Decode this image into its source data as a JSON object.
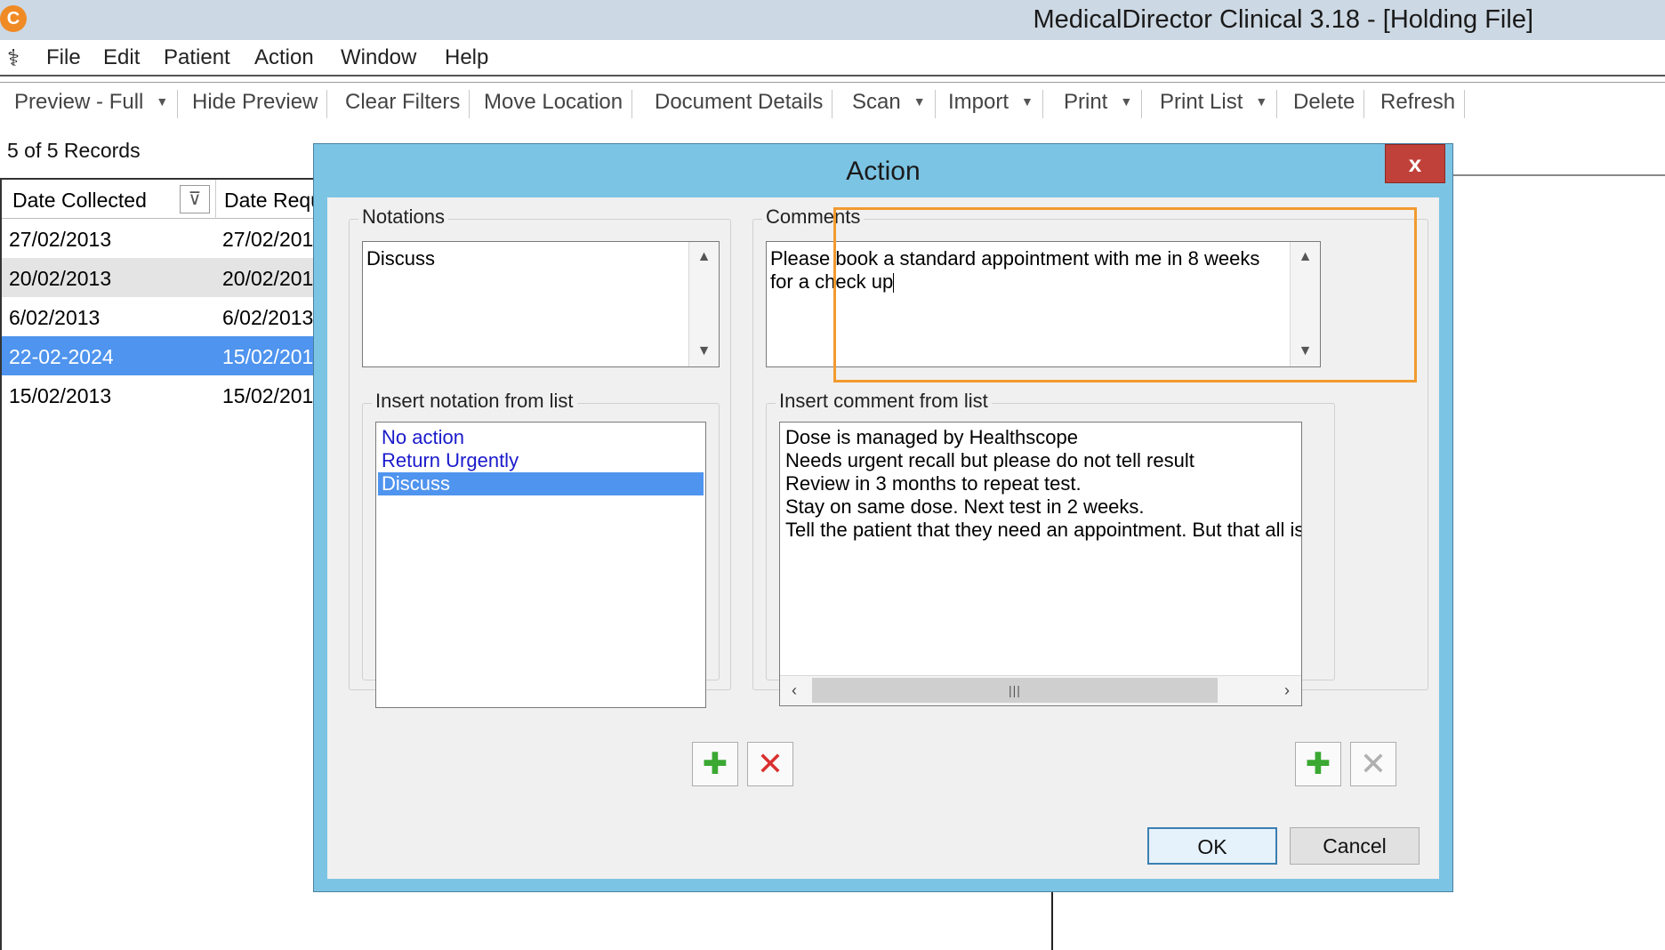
{
  "window": {
    "title": "MedicalDirector Clinical 3.18 - [Holding File]",
    "app_icon": "C"
  },
  "menu": [
    "File",
    "Edit",
    "Patient",
    "Action",
    "Window",
    "Help"
  ],
  "toolbar": {
    "preview": "Preview - Full",
    "hide_preview": "Hide Preview",
    "clear_filters": "Clear Filters",
    "move_location": "Move Location",
    "document_details": "Document Details",
    "scan": "Scan",
    "import": "Import",
    "print": "Print",
    "print_list": "Print List",
    "delete": "Delete",
    "refresh": "Refresh"
  },
  "records_count": "5 of 5 Records",
  "list": {
    "columns": [
      "Date Collected",
      "Date Requ"
    ],
    "rows": [
      {
        "collected": "27/02/2013",
        "requested": "27/02/201"
      },
      {
        "collected": "20/02/2013",
        "requested": "20/02/201"
      },
      {
        "collected": "6/02/2013",
        "requested": "6/02/2013"
      },
      {
        "collected": "22-02-2024",
        "requested": "15/02/201"
      },
      {
        "collected": "15/02/2013",
        "requested": "15/02/201"
      }
    ],
    "selected_row": 3
  },
  "dialog": {
    "title": "Action",
    "close": "x",
    "notations": {
      "label": "Notations",
      "value": "Discuss"
    },
    "comments": {
      "label": "Comments",
      "value": "Please book a standard appointment with me in 8 weeks for a check up"
    },
    "notation_list": {
      "label": "Insert notation from list",
      "items": [
        "No action",
        "Return Urgently",
        "Discuss"
      ],
      "selected": 2
    },
    "comment_list": {
      "label": "Insert comment from list",
      "items": [
        "Dose is managed by Healthscope",
        "Needs urgent recall but please do not tell result",
        "Review in 3 months to repeat test.",
        "Stay on same dose. Next test in 2 weeks.",
        "Tell the patient that they need an appointment.  But that all is"
      ]
    },
    "ok": "OK",
    "cancel": "Cancel"
  },
  "colors": {
    "highlight": "#f29a2e",
    "dialog_frame": "#7cc4e4",
    "selection": "#4f94ee"
  }
}
